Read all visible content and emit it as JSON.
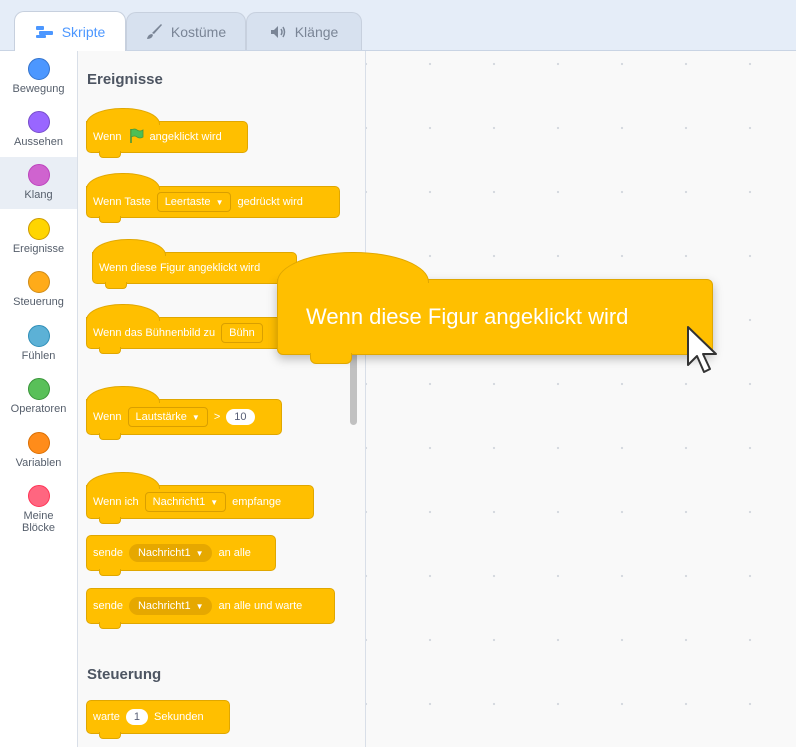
{
  "tabs": [
    {
      "label": "Skripte",
      "icon": "code-icon",
      "active": true
    },
    {
      "label": "Kostüme",
      "icon": "brush-icon",
      "active": false
    },
    {
      "label": "Klänge",
      "icon": "speaker-icon",
      "active": false
    }
  ],
  "categories": [
    {
      "label": "Bewegung",
      "color": "#4c97ff"
    },
    {
      "label": "Aussehen",
      "color": "#9966ff"
    },
    {
      "label": "Klang",
      "color": "#cf63cf"
    },
    {
      "label": "Ereignisse",
      "color": "#ffd500"
    },
    {
      "label": "Steuerung",
      "color": "#ffab19"
    },
    {
      "label": "Fühlen",
      "color": "#5cb1d6"
    },
    {
      "label": "Operatoren",
      "color": "#59c059"
    },
    {
      "label": "Variablen",
      "color": "#ff8c1a"
    },
    {
      "label": "Meine Blöcke",
      "color": "#ff6680"
    }
  ],
  "palette": {
    "events_heading": "Ereignisse",
    "control_heading": "Steuerung",
    "flag_block": {
      "pre": "Wenn",
      "post": "angeklickt wird"
    },
    "key_block": {
      "pre": "Wenn Taste",
      "dropdown": "Leertaste",
      "post": "gedrückt wird"
    },
    "sprite_click_block": "Wenn diese Figur angeklickt wird",
    "backdrop_block": {
      "pre": "Wenn das Bühnenbild zu",
      "dropdown": "Bühn"
    },
    "greater_block": {
      "pre": "Wenn",
      "dropdown": "Lautstärke",
      "op": ">",
      "value": "10"
    },
    "receive_block": {
      "pre": "Wenn ich",
      "dropdown": "Nachricht1",
      "post": "empfange"
    },
    "broadcast_block": {
      "pre": "sende",
      "dropdown": "Nachricht1",
      "post": "an alle"
    },
    "broadcast_wait_block": {
      "pre": "sende",
      "dropdown": "Nachricht1",
      "post": "an alle und warte"
    },
    "wait_block": {
      "pre": "warte",
      "value": "1",
      "post": "Sekunden"
    }
  },
  "dragged_block": "Wenn diese Figur angeklickt wird",
  "colors": {
    "events": "#ffbf00",
    "accent": "#4c97ff"
  }
}
